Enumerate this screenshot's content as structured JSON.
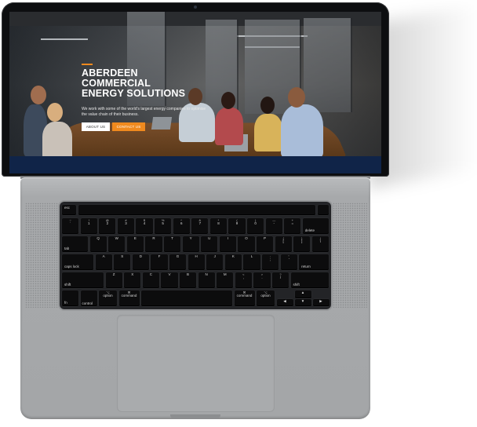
{
  "website": {
    "hero_title_lines": [
      "ABERDEEN",
      "COMMERCIAL",
      "ENERGY SOLUTIONS"
    ],
    "hero_subtitle": "We work with some of the world's largest energy companies to optimise the value chain of their business.",
    "about_button": "ABOUT US",
    "contact_button": "CONTACT US",
    "accent_color": "#f08a1e",
    "band_color": "#102448"
  },
  "keyboard": {
    "fn_row": [
      "esc",
      "",
      ""
    ],
    "number_row": [
      {
        "top": "~",
        "bottom": "`"
      },
      {
        "top": "!",
        "bottom": "1"
      },
      {
        "top": "@",
        "bottom": "2"
      },
      {
        "top": "#",
        "bottom": "3"
      },
      {
        "top": "$",
        "bottom": "4"
      },
      {
        "top": "%",
        "bottom": "5"
      },
      {
        "top": "^",
        "bottom": "6"
      },
      {
        "top": "&",
        "bottom": "7"
      },
      {
        "top": "*",
        "bottom": "8"
      },
      {
        "top": "(",
        "bottom": "9"
      },
      {
        "top": ")",
        "bottom": "0"
      },
      {
        "top": "—",
        "bottom": "-"
      },
      {
        "top": "+",
        "bottom": "="
      }
    ],
    "delete": "delete",
    "tab": "tab",
    "qwerty_row": [
      "Q",
      "W",
      "E",
      "R",
      "T",
      "Y",
      "U",
      "I",
      "O",
      "P"
    ],
    "brackets": [
      {
        "top": "{",
        "bottom": "["
      },
      {
        "top": "}",
        "bottom": "]"
      },
      {
        "top": "|",
        "bottom": "\\"
      }
    ],
    "caps_lock": "caps lock",
    "home_row": [
      "A",
      "S",
      "D",
      "F",
      "G",
      "H",
      "J",
      "K",
      "L"
    ],
    "home_punct": [
      {
        "top": ":",
        "bottom": ";"
      },
      {
        "top": "\"",
        "bottom": "'"
      }
    ],
    "return": "return",
    "shift_left": "shift",
    "bottom_letters": [
      "Z",
      "X",
      "C",
      "V",
      "B",
      "N",
      "M"
    ],
    "bottom_punct": [
      {
        "top": "<",
        "bottom": ","
      },
      {
        "top": ">",
        "bottom": "."
      },
      {
        "top": "?",
        "bottom": "/"
      }
    ],
    "shift_right": "shift",
    "modifiers": {
      "fn": "fn",
      "control": "control",
      "option_symbol": "⌥",
      "option": "option",
      "command_symbol": "⌘",
      "command": "command"
    },
    "arrows": {
      "up": "▲",
      "left": "◀",
      "down": "▼",
      "right": "▶"
    }
  }
}
